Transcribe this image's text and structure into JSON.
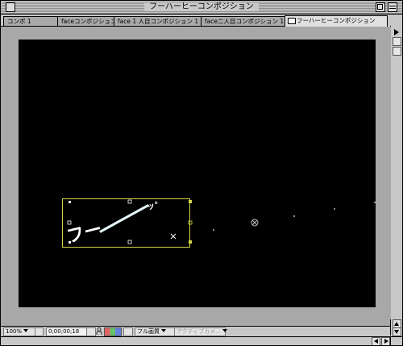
{
  "window": {
    "title": "フーハーヒーコンポジション"
  },
  "tabs": [
    {
      "label": "コンポ 1",
      "active": false
    },
    {
      "label": "faceコンポジション 1",
      "active": false
    },
    {
      "label": "face 1 人目コンポジション 1",
      "active": false
    },
    {
      "label": "face二人目コンポジション 1",
      "active": false
    },
    {
      "label": "フーハーヒーコンポジション",
      "active": true
    }
  ],
  "canvas": {
    "background_color": "#000000",
    "layer_text": "フー",
    "layer_small_text": "ッ°",
    "bounding_box_color": "#d4d64a"
  },
  "bottom_bar": {
    "zoom": "100%",
    "timecode": "0;00;00;18",
    "quality": "フル画質",
    "view": "アクティブカメ..."
  },
  "icons": {
    "close": "close-box-icon",
    "zoom": "zoom-box-icon",
    "collapse": "collapse-box-icon",
    "flowchart": "flowchart-icon",
    "resolution": "resolution-icon",
    "camera": "snapshot-camera-icon",
    "show-snapshot": "person-icon",
    "channel": "rgb-channel-icon",
    "grid": "grid-icon"
  }
}
